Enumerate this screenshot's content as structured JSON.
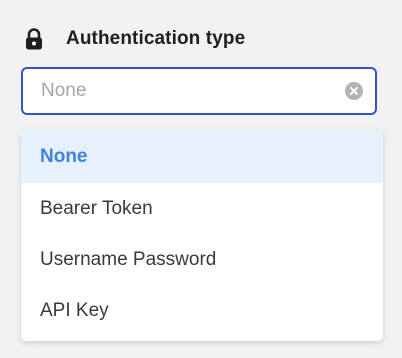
{
  "field": {
    "label": "Authentication type",
    "icon": "lock-icon",
    "value": "None",
    "clear_icon": "clear-icon"
  },
  "dropdown": {
    "options": [
      {
        "label": "None",
        "selected": true
      },
      {
        "label": "Bearer Token",
        "selected": false
      },
      {
        "label": "Username Password",
        "selected": false
      },
      {
        "label": "API Key",
        "selected": false
      }
    ]
  },
  "colors": {
    "focus_border": "#3451d1",
    "selected_bg": "#e6f1fc",
    "selected_text": "#3f83e0"
  }
}
